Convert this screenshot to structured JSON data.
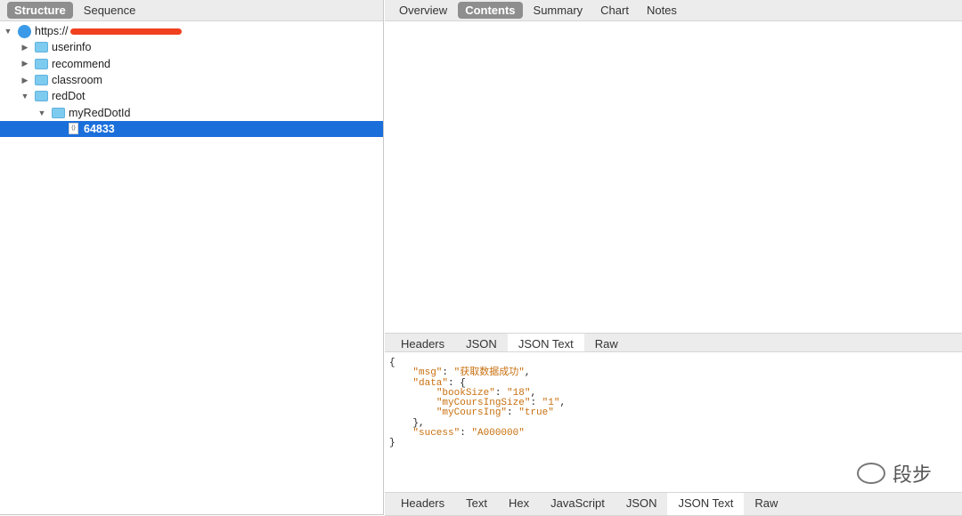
{
  "left_tabs": [
    {
      "label": "Structure",
      "selected": true
    },
    {
      "label": "Sequence",
      "selected": false
    }
  ],
  "tree": [
    {
      "label": "https://",
      "depth": 0,
      "expanded": true,
      "icon": "globe-icon"
    },
    {
      "label": "userinfo",
      "depth": 1,
      "expanded": false,
      "icon": "folder-icon"
    },
    {
      "label": "recommend",
      "depth": 1,
      "expanded": false,
      "icon": "folder-icon"
    },
    {
      "label": "classroom",
      "depth": 1,
      "expanded": false,
      "icon": "folder-icon"
    },
    {
      "label": "redDot",
      "depth": 1,
      "expanded": true,
      "icon": "folder-icon"
    },
    {
      "label": "myRedDotId",
      "depth": 2,
      "expanded": true,
      "icon": "folder-icon"
    },
    {
      "label": "64833",
      "depth": 3,
      "selected": true,
      "icon": "json-file-icon"
    }
  ],
  "right_tabs": [
    {
      "label": "Overview"
    },
    {
      "label": "Contents",
      "selected": true
    },
    {
      "label": "Summary"
    },
    {
      "label": "Chart"
    },
    {
      "label": "Notes"
    }
  ],
  "request_tabs": [
    {
      "label": "Headers"
    },
    {
      "label": "JSON"
    },
    {
      "label": "JSON Text",
      "selected": true
    },
    {
      "label": "Raw"
    }
  ],
  "response_tabs": [
    {
      "label": "Headers"
    },
    {
      "label": "Text"
    },
    {
      "label": "Hex"
    },
    {
      "label": "JavaScript"
    },
    {
      "label": "JSON"
    },
    {
      "label": "JSON Text",
      "selected": true
    },
    {
      "label": "Raw"
    }
  ],
  "json_lines": [
    {
      "indent": "",
      "pre": "{",
      "key": "",
      "sep": "",
      "val": "",
      "post": ""
    },
    {
      "indent": "    ",
      "pre": "",
      "key": "\"msg\"",
      "sep": ": ",
      "val": "\"获取数据成功\"",
      "post": ","
    },
    {
      "indent": "    ",
      "pre": "",
      "key": "\"data\"",
      "sep": ": ",
      "val": "",
      "post": "{"
    },
    {
      "indent": "        ",
      "pre": "",
      "key": "\"bookSize\"",
      "sep": ": ",
      "val": "\"18\"",
      "post": ","
    },
    {
      "indent": "        ",
      "pre": "",
      "key": "\"myCoursIngSize\"",
      "sep": ": ",
      "val": "\"1\"",
      "post": ","
    },
    {
      "indent": "        ",
      "pre": "",
      "key": "\"myCoursIng\"",
      "sep": ": ",
      "val": "\"true\"",
      "post": ""
    },
    {
      "indent": "    ",
      "pre": "},",
      "key": "",
      "sep": "",
      "val": "",
      "post": ""
    },
    {
      "indent": "    ",
      "pre": "",
      "key": "\"sucess\"",
      "sep": ": ",
      "val": "\"A000000\"",
      "post": ""
    },
    {
      "indent": "",
      "pre": "}",
      "key": "",
      "sep": "",
      "val": "",
      "post": ""
    }
  ],
  "watermark": "段步"
}
